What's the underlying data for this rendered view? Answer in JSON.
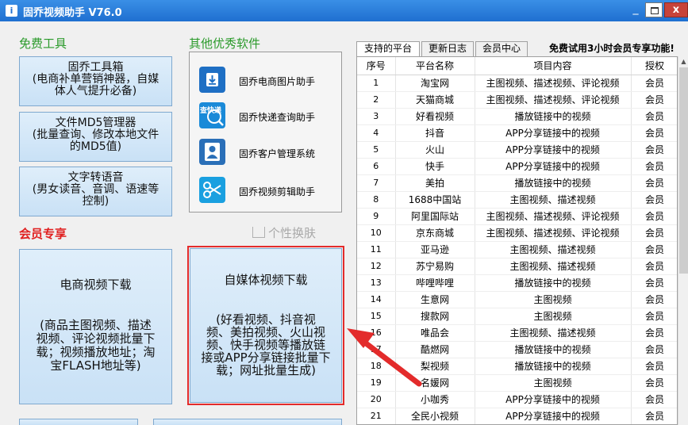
{
  "window": {
    "title": "固乔视频助手 V76.0",
    "icon_glyph": "i",
    "minimize_glyph": "_",
    "close_glyph": "x"
  },
  "free_tools": {
    "label": "免费工具",
    "buttons": [
      {
        "lines": [
          "固乔工具箱",
          "(电商补单营销神器，自媒",
          "体人气提升必备)"
        ]
      },
      {
        "lines": [
          "文件MD5管理器",
          "(批量查询、修改本地文件",
          "的MD5值)"
        ]
      },
      {
        "lines": [
          "文字转语音",
          "(男女读音、音调、语速等",
          "控制)"
        ]
      }
    ]
  },
  "other_software": {
    "label": "其他优秀软件",
    "items": [
      {
        "label": "固乔电商图片助手",
        "icon": "download-icon"
      },
      {
        "label": "固乔快递查询助手",
        "icon": "express-search-icon"
      },
      {
        "label": "固乔客户管理系统",
        "icon": "customer-icon"
      },
      {
        "label": "固乔视频剪辑助手",
        "icon": "scissors-icon"
      }
    ],
    "express_icon_text": "查快递"
  },
  "skin_label": "个性换肤",
  "member": {
    "label": "会员专享",
    "ecommerce_button": {
      "title": "电商视频下载",
      "lines": [
        "(商品主图视频、描述",
        "视频、评论视频批量下",
        "载；视频播放地址；淘",
        "宝FLASH地址等)"
      ]
    },
    "selfmedia_button": {
      "title": "自媒体视频下载",
      "lines": [
        "(好看视频、抖音视",
        "频、美拍视频、火山视",
        "频、快手视频等播放链",
        "接或APP分享链接批量下",
        "载；网址批量生成)"
      ]
    }
  },
  "tabs": [
    {
      "label": "支持的平台",
      "active": true
    },
    {
      "label": "更新日志",
      "active": false
    },
    {
      "label": "会员中心",
      "active": false
    }
  ],
  "trial_notice": "免费试用3小时会员专享功能!",
  "table": {
    "headers": [
      "序号",
      "平台名称",
      "项目内容",
      "授权"
    ],
    "rows": [
      [
        "1",
        "淘宝网",
        "主图视频、描述视频、评论视频",
        "会员"
      ],
      [
        "2",
        "天猫商城",
        "主图视频、描述视频、评论视频",
        "会员"
      ],
      [
        "3",
        "好看视频",
        "播放链接中的视频",
        "会员"
      ],
      [
        "4",
        "抖音",
        "APP分享链接中的视频",
        "会员"
      ],
      [
        "5",
        "火山",
        "APP分享链接中的视频",
        "会员"
      ],
      [
        "6",
        "快手",
        "APP分享链接中的视频",
        "会员"
      ],
      [
        "7",
        "美拍",
        "播放链接中的视频",
        "会员"
      ],
      [
        "8",
        "1688中国站",
        "主图视频、描述视频",
        "会员"
      ],
      [
        "9",
        "阿里国际站",
        "主图视频、描述视频、评论视频",
        "会员"
      ],
      [
        "10",
        "京东商城",
        "主图视频、描述视频、评论视频",
        "会员"
      ],
      [
        "11",
        "亚马逊",
        "主图视频、描述视频",
        "会员"
      ],
      [
        "12",
        "苏宁易购",
        "主图视频、描述视频",
        "会员"
      ],
      [
        "13",
        "哔哩哔哩",
        "播放链接中的视频",
        "会员"
      ],
      [
        "14",
        "生意网",
        "主图视频",
        "会员"
      ],
      [
        "15",
        "搜款网",
        "主图视频",
        "会员"
      ],
      [
        "16",
        "唯品会",
        "主图视频、描述视频",
        "会员"
      ],
      [
        "17",
        "酷燃网",
        "播放链接中的视频",
        "会员"
      ],
      [
        "18",
        "梨视频",
        "播放链接中的视频",
        "会员"
      ],
      [
        "19",
        "名媛网",
        "主图视频",
        "会员"
      ],
      [
        "20",
        "小咖秀",
        "APP分享链接中的视频",
        "会员"
      ],
      [
        "21",
        "全民小视频",
        "APP分享链接中的视频",
        "会员"
      ]
    ]
  },
  "colors": {
    "accent_blue": "#1f6fd0",
    "green_label": "#2a9a2a",
    "red_label": "#e02020",
    "highlight_red": "#e32b2b"
  }
}
